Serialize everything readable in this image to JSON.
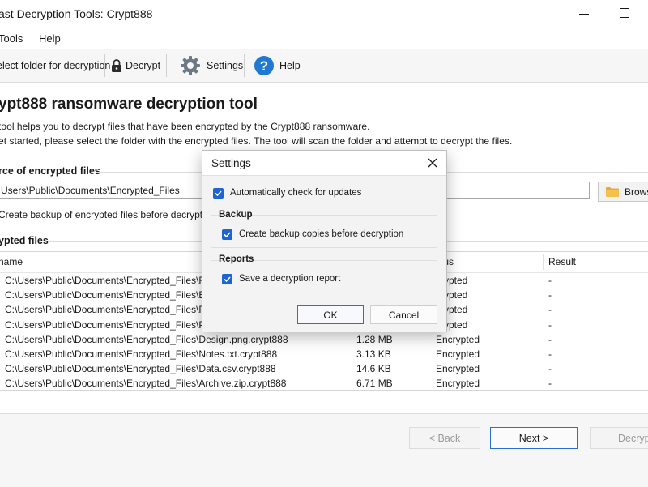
{
  "window": {
    "title": "ast Decryption Tools: Crypt888"
  },
  "menu": {
    "tools": "Tools",
    "help": "Help"
  },
  "toolbar": {
    "select_folder": "elect folder for decryption",
    "decrypt": "Decrypt",
    "settings": "Settings",
    "help": "Help"
  },
  "main": {
    "heading": "ypt888 ransomware decryption tool",
    "desc_line1": "tool helps you to decrypt files that have been encrypted by the Crypt888 ransomware.",
    "desc_line2": "et started, please select the folder with the encrypted files. The tool will scan the folder and attempt to decrypt the files.",
    "source_label": "rce of encrypted files",
    "source_path": "Users\\Public\\Documents\\Encrypted_Files",
    "browse_label": "Browse",
    "backup_label": "Create backup of encrypted files before decryption",
    "files_label": "ypted files"
  },
  "table": {
    "headers": {
      "name": "name",
      "status": "tus",
      "result": "Result"
    },
    "rows": [
      {
        "name": "C:\\Users\\Public\\Documents\\Encrypted_Files\\Repo",
        "size": "",
        "status": "crypted",
        "result": "-"
      },
      {
        "name": "C:\\Users\\Public\\Documents\\Encrypted_Files\\Budg",
        "size": "",
        "status": "crypted",
        "result": "-"
      },
      {
        "name": "C:\\Users\\Public\\Documents\\Encrypted_Files\\Prese",
        "size": "",
        "status": "crypted",
        "result": "-"
      },
      {
        "name": "C:\\Users\\Public\\Documents\\Encrypted_Files\\Phot",
        "size": "",
        "status": "crypted",
        "result": "-"
      },
      {
        "name": "C:\\Users\\Public\\Documents\\Encrypted_Files\\Design.png.crypt888",
        "size": "1.28 MB",
        "status": "Encrypted",
        "result": "-"
      },
      {
        "name": "C:\\Users\\Public\\Documents\\Encrypted_Files\\Notes.txt.crypt888",
        "size": "3.13 KB",
        "status": "Encrypted",
        "result": "-"
      },
      {
        "name": "C:\\Users\\Public\\Documents\\Encrypted_Files\\Data.csv.crypt888",
        "size": "14.6 KB",
        "status": "Encrypted",
        "result": "-"
      },
      {
        "name": "C:\\Users\\Public\\Documents\\Encrypted_Files\\Archive.zip.crypt888",
        "size": "6.71 MB",
        "status": "Encrypted",
        "result": "-"
      }
    ]
  },
  "nav": {
    "back": "< Back",
    "next": "Next >",
    "decrypt": "Decryp"
  },
  "dialog": {
    "title": "Settings",
    "auto_update": "Automatically check for updates",
    "backup_group": "Backup",
    "backup_option": "Create backup copies before decryption",
    "reports_group": "Reports",
    "report_option": "Save a decryption report",
    "ok": "OK",
    "cancel": "Cancel"
  },
  "colors": {
    "accent": "#1e64d2",
    "help_icon": "#1f78d1",
    "folder_icon": "#e8a93a"
  }
}
